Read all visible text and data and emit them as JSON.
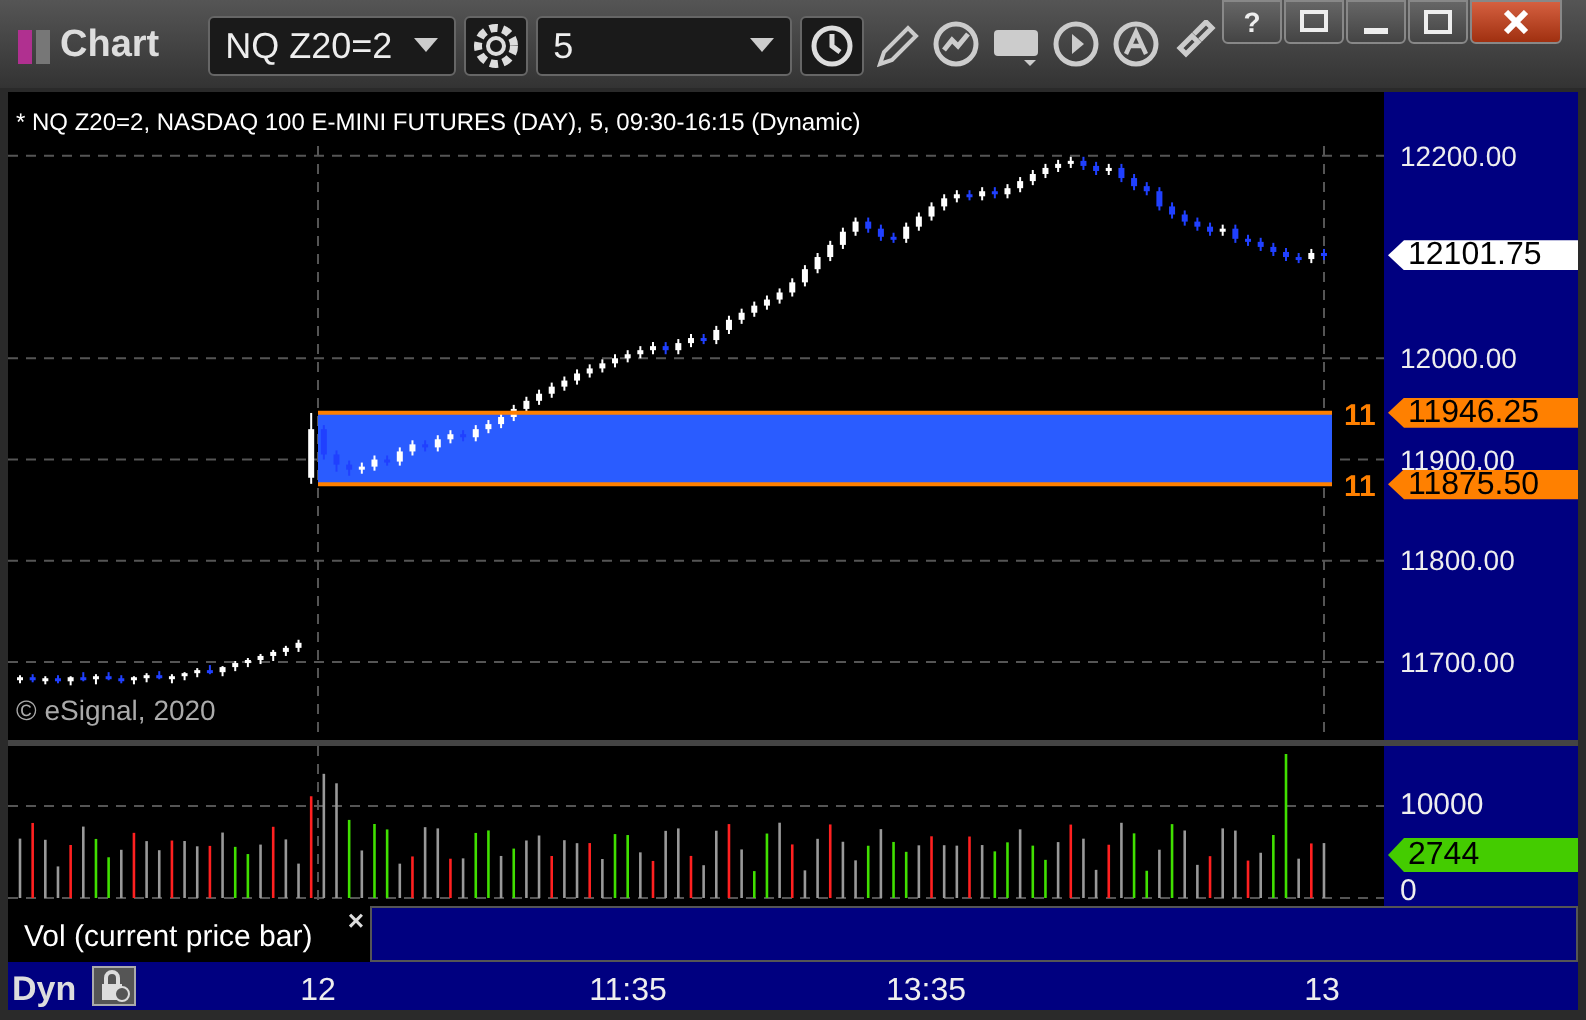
{
  "window": {
    "title": "Chart",
    "controls": [
      {
        "kind": "help",
        "label": "?"
      },
      {
        "kind": "restore-menu"
      },
      {
        "kind": "minimize"
      },
      {
        "kind": "maximize"
      },
      {
        "kind": "close"
      }
    ]
  },
  "toolbar": {
    "symbol": "NQ Z20=2",
    "interval": "5"
  },
  "price_pane": {
    "header": "* NQ Z20=2, NASDAQ 100 E-MINI FUTURES (DAY), 5, 09:30-16:15 (Dynamic)",
    "markers": [
      {
        "label": "12101.75",
        "color": "#ffffff"
      },
      {
        "label": "11946.25",
        "color": "#ff8000",
        "stub": "11"
      },
      {
        "label": "11875.50",
        "color": "#ff8000",
        "stub": "11"
      }
    ],
    "copyright": "© eSignal, 2020",
    "chart_data": {
      "type": "candlestick",
      "grid": true,
      "categories": [
        null,
        null,
        null,
        null,
        null,
        null,
        null,
        null,
        null,
        null,
        null,
        null,
        null,
        null,
        null,
        null,
        null,
        null,
        null,
        null,
        null,
        null,
        null,
        null,
        null,
        null,
        null,
        null,
        null,
        null,
        null,
        null,
        null,
        null,
        null,
        null,
        null,
        null,
        null,
        null,
        null,
        null,
        null,
        null,
        null,
        null,
        null,
        null,
        null,
        null,
        null,
        null,
        null,
        null,
        null,
        null,
        null,
        null,
        null,
        null,
        null,
        null,
        null,
        null,
        null,
        null,
        null,
        null,
        null,
        null,
        null,
        null,
        null,
        null,
        null,
        null,
        null,
        null,
        null,
        null,
        null,
        null,
        null,
        null,
        null,
        null,
        null,
        null,
        null,
        null,
        null,
        null,
        null,
        null,
        null,
        null,
        null,
        null,
        null,
        null,
        null,
        null,
        null,
        null
      ],
      "ylim": [
        11623,
        12263
      ],
      "yticks": [
        {
          "value": 12200,
          "label": "12200.00"
        },
        {
          "value": 12000,
          "label": "12000.00"
        },
        {
          "value": 11900,
          "label": "11900.00"
        },
        {
          "value": 11800,
          "label": "11800.00"
        },
        {
          "value": 11700,
          "label": "11700.00"
        }
      ],
      "ohlc": [
        [
          11683,
          11687,
          11679,
          11685
        ],
        [
          11685,
          11688,
          11680,
          11682
        ],
        [
          11682,
          11686,
          11678,
          11684
        ],
        [
          11684,
          11687,
          11679,
          11681
        ],
        [
          11681,
          11686,
          11677,
          11685
        ],
        [
          11685,
          11690,
          11681,
          11683
        ],
        [
          11683,
          11688,
          11678,
          11686
        ],
        [
          11686,
          11690,
          11682,
          11684
        ],
        [
          11684,
          11687,
          11679,
          11682
        ],
        [
          11682,
          11686,
          11678,
          11685
        ],
        [
          11685,
          11689,
          11680,
          11687
        ],
        [
          11687,
          11691,
          11683,
          11684
        ],
        [
          11684,
          11688,
          11679,
          11686
        ],
        [
          11686,
          11690,
          11682,
          11689
        ],
        [
          11689,
          11694,
          11685,
          11692
        ],
        [
          11692,
          11697,
          11688,
          11690
        ],
        [
          11690,
          11696,
          11686,
          11695
        ],
        [
          11695,
          11701,
          11691,
          11699
        ],
        [
          11699,
          11704,
          11695,
          11702
        ],
        [
          11702,
          11708,
          11698,
          11706
        ],
        [
          11706,
          11712,
          11701,
          11710
        ],
        [
          11710,
          11716,
          11706,
          11714
        ],
        [
          11714,
          11722,
          11710,
          11719
        ],
        [
          11882,
          11946,
          11876,
          11930
        ],
        [
          11930,
          11934,
          11900,
          11905
        ],
        [
          11905,
          11909,
          11888,
          11895
        ],
        [
          11895,
          11899,
          11884,
          11890
        ],
        [
          11890,
          11897,
          11886,
          11893
        ],
        [
          11893,
          11904,
          11889,
          11900
        ],
        [
          11900,
          11904,
          11894,
          11898
        ],
        [
          11898,
          11912,
          11894,
          11908
        ],
        [
          11908,
          11919,
          11904,
          11915
        ],
        [
          11915,
          11919,
          11908,
          11912
        ],
        [
          11912,
          11924,
          11908,
          11920
        ],
        [
          11920,
          11929,
          11916,
          11925
        ],
        [
          11925,
          11929,
          11918,
          11922
        ],
        [
          11922,
          11934,
          11918,
          11930
        ],
        [
          11930,
          11939,
          11926,
          11935
        ],
        [
          11935,
          11946,
          11931,
          11942
        ],
        [
          11942,
          11954,
          11938,
          11950
        ],
        [
          11950,
          11962,
          11946,
          11958
        ],
        [
          11958,
          11969,
          11954,
          11965
        ],
        [
          11965,
          11976,
          11961,
          11972
        ],
        [
          11972,
          11982,
          11968,
          11978
        ],
        [
          11978,
          11989,
          11974,
          11985
        ],
        [
          11985,
          11994,
          11981,
          11990
        ],
        [
          11990,
          11999,
          11986,
          11995
        ],
        [
          11995,
          12004,
          11991,
          12000
        ],
        [
          12000,
          12008,
          11996,
          12004
        ],
        [
          12004,
          12012,
          12000,
          12008
        ],
        [
          12008,
          12016,
          12004,
          12012
        ],
        [
          12012,
          12016,
          12004,
          12008
        ],
        [
          12008,
          12019,
          12004,
          12015
        ],
        [
          12015,
          12024,
          12011,
          12020
        ],
        [
          12020,
          12024,
          12014,
          12018
        ],
        [
          12018,
          12032,
          12014,
          12028
        ],
        [
          12028,
          12042,
          12024,
          12038
        ],
        [
          12038,
          12049,
          12034,
          12045
        ],
        [
          12045,
          12056,
          12041,
          12052
        ],
        [
          12052,
          12062,
          12048,
          12058
        ],
        [
          12058,
          12069,
          12054,
          12065
        ],
        [
          12065,
          12079,
          12061,
          12075
        ],
        [
          12075,
          12092,
          12071,
          12088
        ],
        [
          12088,
          12104,
          12084,
          12100
        ],
        [
          12100,
          12116,
          12096,
          12112
        ],
        [
          12112,
          12129,
          12108,
          12125
        ],
        [
          12125,
          12139,
          12121,
          12135
        ],
        [
          12135,
          12139,
          12124,
          12128
        ],
        [
          12128,
          12132,
          12116,
          12120
        ],
        [
          12120,
          12124,
          12114,
          12118
        ],
        [
          12118,
          12134,
          12114,
          12130
        ],
        [
          12130,
          12144,
          12126,
          12140
        ],
        [
          12140,
          12154,
          12136,
          12150
        ],
        [
          12150,
          12162,
          12146,
          12158
        ],
        [
          12158,
          12166,
          12154,
          12162
        ],
        [
          12162,
          12166,
          12156,
          12160
        ],
        [
          12160,
          12169,
          12156,
          12165
        ],
        [
          12165,
          12169,
          12158,
          12162
        ],
        [
          12162,
          12172,
          12158,
          12168
        ],
        [
          12168,
          12179,
          12164,
          12175
        ],
        [
          12175,
          12186,
          12171,
          12182
        ],
        [
          12182,
          12192,
          12178,
          12188
        ],
        [
          12188,
          12196,
          12184,
          12192
        ],
        [
          12192,
          12199,
          12188,
          12195
        ],
        [
          12195,
          12199,
          12186,
          12190
        ],
        [
          12190,
          12194,
          12181,
          12185
        ],
        [
          12185,
          12192,
          12181,
          12188
        ],
        [
          12188,
          12192,
          12174,
          12178
        ],
        [
          12178,
          12182,
          12166,
          12170
        ],
        [
          12170,
          12174,
          12161,
          12165
        ],
        [
          12165,
          12169,
          12146,
          12150
        ],
        [
          12150,
          12154,
          12138,
          12142
        ],
        [
          12142,
          12146,
          12131,
          12135
        ],
        [
          12135,
          12139,
          12126,
          12130
        ],
        [
          12130,
          12134,
          12121,
          12125
        ],
        [
          12125,
          12132,
          12121,
          12128
        ],
        [
          12128,
          12132,
          12114,
          12118
        ],
        [
          12118,
          12122,
          12111,
          12115
        ],
        [
          12115,
          12119,
          12106,
          12110
        ],
        [
          12110,
          12114,
          12101,
          12105
        ],
        [
          12105,
          12109,
          12096,
          12100
        ],
        [
          12100,
          12104,
          12094,
          12098
        ],
        [
          12098,
          12108,
          12094,
          12104
        ],
        [
          12104,
          12108,
          12097,
          12101.75
        ]
      ]
    }
  },
  "volume_pane": {
    "ticks": [
      "10000",
      "0"
    ],
    "marker": {
      "label": "2744",
      "color": "#44cc00"
    },
    "legend": "Vol (current price bar)",
    "legend_close": "×"
  },
  "time_axis": {
    "mode": "Dyn",
    "labels": [
      "12",
      "11:35",
      "13:35",
      "13"
    ]
  }
}
